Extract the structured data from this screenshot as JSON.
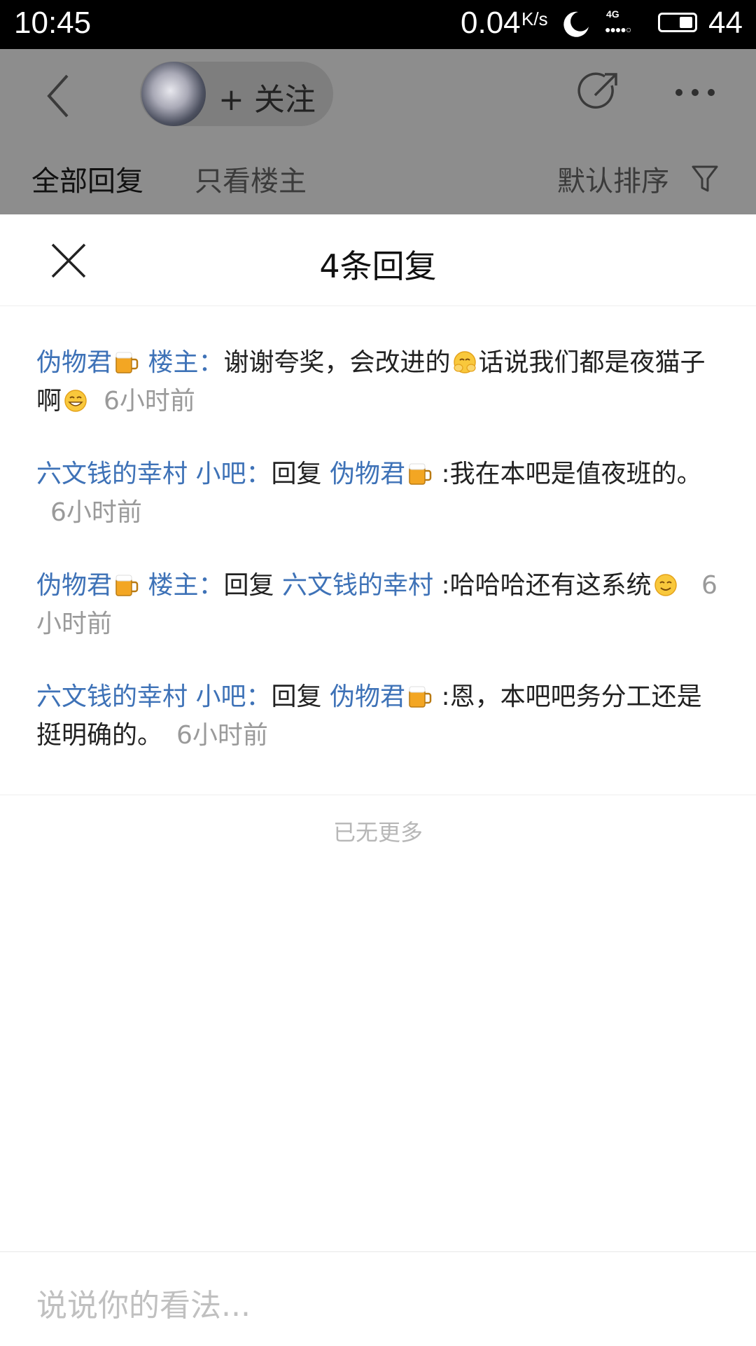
{
  "status_bar": {
    "time": "10:45",
    "net_speed": "0.04",
    "net_speed_unit": "K/s",
    "network_type": "4G",
    "signal_dots": "●●●●○",
    "battery_level": "44"
  },
  "header": {
    "follow_label": "+ 关注",
    "tabs": [
      {
        "label": "全部回复",
        "selected": true
      },
      {
        "label": "只看楼主",
        "selected": false
      }
    ],
    "sort_label": "默认排序"
  },
  "sheet": {
    "title": "4条回复",
    "replies": [
      {
        "user": "伪物君",
        "user_emoji": "beer-mug-icon",
        "role": "楼主",
        "separator": "：",
        "text_part1": "谢谢夸奖，会改进的",
        "inline_emoji_1": "blushing-hands-emoji",
        "text_part2": "话说我们都是夜猫子啊",
        "inline_emoji_2": "grinning-emoji",
        "time": "6小时前"
      },
      {
        "user": "六文钱的幸村",
        "role": "小吧",
        "separator": "：",
        "reply_prefix": "回复",
        "reply_to": "伪物君",
        "reply_to_emoji": "beer-mug-icon",
        "text": ":我在本吧是值夜班的。",
        "time": "6小时前"
      },
      {
        "user": "伪物君",
        "user_emoji": "beer-mug-icon",
        "role": "楼主",
        "separator": "：",
        "reply_prefix": "回复",
        "reply_to": "六文钱的幸村",
        "text": ":哈哈哈还有这系统",
        "inline_emoji_1": "smiling-emoji",
        "time": "6小时前"
      },
      {
        "user": "六文钱的幸村",
        "role": "小吧",
        "separator": "：",
        "reply_prefix": "回复",
        "reply_to": "伪物君",
        "reply_to_emoji": "beer-mug-icon",
        "text": ":恩，本吧吧务分工还是挺明确的。",
        "time": "6小时前"
      }
    ],
    "no_more": "已无更多",
    "input_placeholder": "说说你的看法..."
  },
  "colors": {
    "link_blue": "#3e72b7",
    "dim_overlay": "#8d8d8d",
    "muted_gray": "#9a9a9a"
  }
}
